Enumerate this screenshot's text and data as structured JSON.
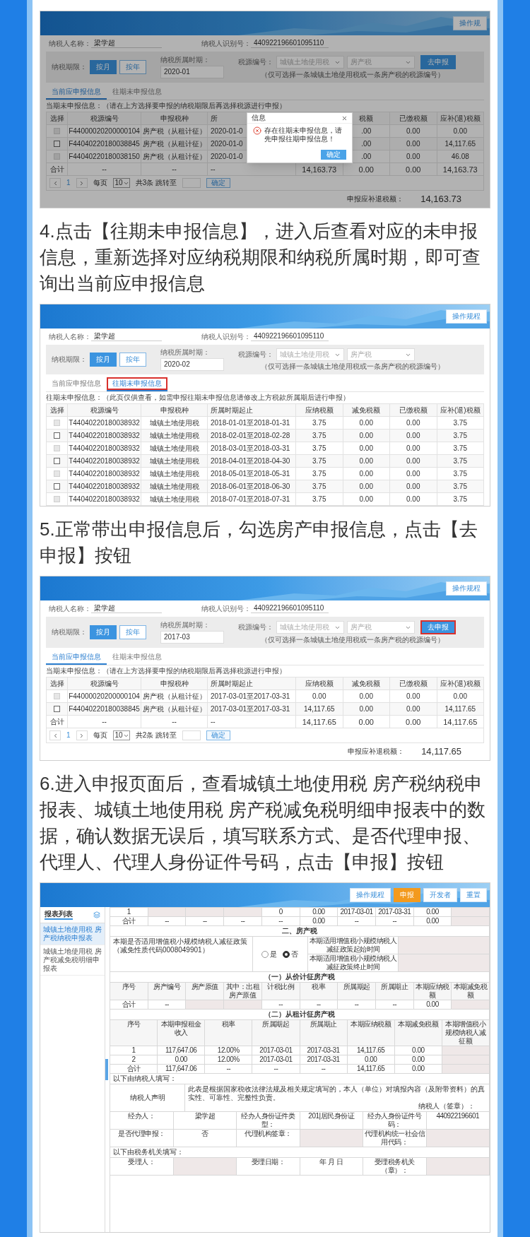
{
  "blocks": [
    {
      "kind": "query-screen",
      "banner_buttons": [
        {
          "label": "操作规",
          "primary": false
        }
      ],
      "taxpayer_name_label": "纳税人名称：",
      "taxpayer_name": "梁学超",
      "taxpayer_id_label": "纳税人识别号：",
      "taxpayer_id": "440922196601095110",
      "period_label": "纳税期限：",
      "period_options": [
        {
          "label": "按月",
          "selected": true
        },
        {
          "label": "按年",
          "selected": false
        }
      ],
      "tax_period_label": "纳税所属时期：",
      "tax_period": "2020-01",
      "source_label": "税源编号：",
      "source_selects": [
        {
          "placeholder": "城镇土地使用税"
        },
        {
          "placeholder": "房产税"
        }
      ],
      "submit_button": {
        "label": "去申报",
        "highlighted": false
      },
      "source_hint": "（仅可选择一条城镇土地使用税或一条房产税的税源编号）",
      "tabs": [
        {
          "label": "当前应申报信息",
          "selected": true,
          "highlighted": false
        },
        {
          "label": "往期未申报信息",
          "selected": false,
          "highlighted": false
        }
      ],
      "table_hint": "当期未申报信息：（请在上方选择要申报的纳税期限后再选择税源进行申报）",
      "select_column": "选择",
      "columns": [
        "税源编号",
        "申报税种",
        "所",
        null,
        "税额",
        "已缴税额",
        "应补(退)税额"
      ],
      "rows": [
        {
          "kind": "item",
          "disabled": true,
          "cells": [
            "F44000020200000104",
            "房产税（从租计征）",
            "2020-01-0",
            null,
            ".00",
            "0.00",
            "0.00"
          ]
        },
        {
          "kind": "item",
          "disabled": false,
          "cells": [
            "F44040220180038845",
            "房产税（从租计征）",
            "2020-01-0",
            null,
            ".00",
            "0.00",
            "14,117.65"
          ]
        },
        {
          "kind": "item",
          "disabled": true,
          "cells": [
            "F44040220180038150",
            "房产税（从租计征）",
            "2020-01-0",
            null,
            ".00",
            "0.00",
            "46.08"
          ]
        },
        {
          "kind": "total",
          "label": "合计",
          "cells": [
            "--",
            "--",
            "--",
            "14,163.73",
            "0.00",
            "0.00",
            "14,163.73"
          ]
        }
      ],
      "pagination": {
        "page": "1",
        "per_page_label": "每页",
        "per_page": "10",
        "count_label": "共3条 跳转至",
        "go_button": "确定"
      },
      "total_label": "申报应补退税额：",
      "total": "14,163.73",
      "dialog": {
        "title": "信息",
        "message": "存在往期未申报信息，请先申报往期申报信息！",
        "button": "确定"
      }
    },
    {
      "kind": "text",
      "text": "4.点击【往期未申报信息】，进入后查看对应的未申报信息，重新选择对应纳税期限和纳税所属时期，即可查询出当前应申报信息"
    },
    {
      "kind": "query-screen",
      "banner_buttons": [
        {
          "label": "操作规程",
          "primary": false
        }
      ],
      "taxpayer_name_label": "纳税人名称：",
      "taxpayer_name": "梁学超",
      "taxpayer_id_label": "纳税人识别号：",
      "taxpayer_id": "440922196601095110",
      "period_label": "纳税期限：",
      "period_options": [
        {
          "label": "按月",
          "selected": true
        },
        {
          "label": "按年",
          "selected": false
        }
      ],
      "tax_period_label": "纳税所属时期：",
      "tax_period": "2020-02",
      "source_label": "税源编号：",
      "source_selects": [
        {
          "placeholder": "城镇土地使用税"
        },
        {
          "placeholder": "房产税"
        }
      ],
      "source_hint": "（仅可选择一条城镇土地使用税或一条房产税的税源编号）",
      "tabs": [
        {
          "label": "当前应申报信息",
          "selected": false,
          "highlighted": false
        },
        {
          "label": "往期未申报信息",
          "selected": true,
          "highlighted": true
        }
      ],
      "table_hint": "往期未申报信息：（此页仅供查看，如需申报往期未申报信息请修改上方税款所属期后进行申报）",
      "select_column": "选择",
      "columns": [
        "税源编号",
        "申报税种",
        "所属时期起止",
        "应纳税额",
        "减免税额",
        "已缴税额",
        "应补(退)税额"
      ],
      "rows": [
        {
          "kind": "item",
          "disabled": true,
          "cells": [
            "T44040220180038932",
            "城镇土地使用税",
            "2018-01-01至2018-01-31",
            "3.75",
            "0.00",
            "0.00",
            "3.75"
          ]
        },
        {
          "kind": "item",
          "disabled": false,
          "cells": [
            "T44040220180038932",
            "城镇土地使用税",
            "2018-02-01至2018-02-28",
            "3.75",
            "0.00",
            "0.00",
            "3.75"
          ]
        },
        {
          "kind": "item",
          "disabled": true,
          "cells": [
            "T44040220180038932",
            "城镇土地使用税",
            "2018-03-01至2018-03-31",
            "3.75",
            "0.00",
            "0.00",
            "3.75"
          ]
        },
        {
          "kind": "item",
          "disabled": false,
          "cells": [
            "T44040220180038932",
            "城镇土地使用税",
            "2018-04-01至2018-04-30",
            "3.75",
            "0.00",
            "0.00",
            "3.75"
          ]
        },
        {
          "kind": "item",
          "disabled": true,
          "cells": [
            "T44040220180038932",
            "城镇土地使用税",
            "2018-05-01至2018-05-31",
            "3.75",
            "0.00",
            "0.00",
            "3.75"
          ]
        },
        {
          "kind": "item",
          "disabled": false,
          "cells": [
            "T44040220180038932",
            "城镇土地使用税",
            "2018-06-01至2018-06-30",
            "3.75",
            "0.00",
            "0.00",
            "3.75"
          ]
        },
        {
          "kind": "item",
          "disabled": true,
          "cells": [
            "T44040220180038932",
            "城镇土地使用税",
            "2018-07-01至2018-07-31",
            "3.75",
            "0.00",
            "0.00",
            "3.75"
          ]
        }
      ]
    },
    {
      "kind": "text",
      "text": "5.正常带出申报信息后，勾选房产申报信息，点击【去申报】按钮"
    },
    {
      "kind": "query-screen",
      "banner_buttons": [
        {
          "label": "操作规程",
          "primary": false
        }
      ],
      "taxpayer_name_label": "纳税人名称：",
      "taxpayer_name": "梁学超",
      "taxpayer_id_label": "纳税人识别号：",
      "taxpayer_id": "440922196601095110",
      "period_label": "纳税期限：",
      "period_options": [
        {
          "label": "按月",
          "selected": true
        },
        {
          "label": "按年",
          "selected": false
        }
      ],
      "tax_period_label": "纳税所属时期：",
      "tax_period": "2017-03",
      "source_label": "税源编号：",
      "source_selects": [
        {
          "placeholder": "城镇土地使用税"
        },
        {
          "placeholder": "房产税"
        }
      ],
      "submit_button": {
        "label": "去申报",
        "highlighted": true
      },
      "source_hint": "（仅可选择一条城镇土地使用税或一条房产税的税源编号）",
      "tabs": [
        {
          "label": "当前应申报信息",
          "selected": true,
          "highlighted": false
        },
        {
          "label": "往期未申报信息",
          "selected": false,
          "highlighted": false
        }
      ],
      "table_hint": "当期未申报信息：（请在上方选择要申报的纳税期限后再选择税源进行申报）",
      "select_column": "选择",
      "columns": [
        "税源编号",
        "申报税种",
        "所属时期起止",
        "应纳税额",
        "减免税额",
        "已缴税额",
        "应补(退)税额"
      ],
      "rows": [
        {
          "kind": "item",
          "disabled": true,
          "cells": [
            "F44000020200000104",
            "房产税（从租计征）",
            "2017-03-01至2017-03-31",
            "0.00",
            "0.00",
            "0.00",
            "0.00"
          ]
        },
        {
          "kind": "item",
          "disabled": false,
          "cells": [
            "F44040220180038845",
            "房产税（从租计征）",
            "2017-03-01至2017-03-31",
            "14,117.65",
            "0.00",
            "0.00",
            "14,117.65"
          ]
        },
        {
          "kind": "total",
          "label": "合计",
          "cells": [
            "--",
            "--",
            "--",
            "14,117.65",
            "0.00",
            "0.00",
            "14,117.65"
          ]
        }
      ],
      "pagination": {
        "page": "1",
        "per_page_label": "每页",
        "per_page": "10",
        "count_label": "共2条 跳转至",
        "go_button": "确定"
      },
      "total_label": "申报应补退税额：",
      "total": "14,117.65"
    },
    {
      "kind": "text",
      "text": "6.进入申报页面后，查看城镇土地使用税 房产税纳税申报表、城镇土地使用税 房产税减免税明细申报表中的数据，确认数据无误后，填写联系方式、是否代理申报、代理人、代理人身份证件号码，点击【申报】按钮"
    },
    {
      "kind": "form-screen",
      "banner_buttons": [
        {
          "label": "操作规程",
          "primary": false
        },
        {
          "label": "申报",
          "primary": true
        },
        {
          "label": "开发者",
          "primary": false
        },
        {
          "label": "重置",
          "primary": false
        }
      ],
      "sidebar": {
        "title": "报表列表",
        "items": [
          {
            "label": "城镇土地使用税 房产税纳税申报表",
            "selected": true
          },
          {
            "label": "城镇土地使用税 房产税减免税明细申报表",
            "selected": false
          }
        ]
      },
      "form_rows": [
        {
          "kind": "cells",
          "cells": [
            "1",
            null,
            null,
            null,
            "0",
            "0.00",
            "2017-03-01",
            "2017-03-31",
            "0.00",
            null
          ]
        },
        {
          "kind": "cells",
          "cells": [
            "合计",
            "--",
            "--",
            "--",
            "--",
            "0.00",
            "--",
            "--",
            "0.00",
            null
          ]
        },
        {
          "kind": "section",
          "text": "二、房产税"
        },
        {
          "kind": "policy",
          "label": "本期是否适用增值税小规模纳税人减征政策（减免性质代码0008049901）",
          "options": [
            {
              "label": "是",
              "selected": false
            },
            {
              "label": "否",
              "selected": true
            }
          ],
          "start_label": "本期适用增值税小规模纳税人减征政策起始时间",
          "end_label": "本期适用增值税小规模纳税人减征政策终止时间"
        },
        {
          "kind": "section",
          "text": "（一）从价计征房产税"
        },
        {
          "kind": "header",
          "cells": [
            "序号",
            "房产编号",
            "房产原值",
            "其中：出租房产原值",
            "计税比例",
            "税率",
            "所属期起",
            "所属期止",
            "本期应纳税额",
            "本期减免税额"
          ]
        },
        {
          "kind": "cells",
          "cells": [
            "合计",
            "--",
            null,
            null,
            "--",
            "--",
            "--",
            "--",
            "0.00",
            null
          ]
        },
        {
          "kind": "section",
          "text": "（二）从租计征房产税"
        },
        {
          "kind": "header",
          "cells": [
            "序号",
            "本期申报租金收入",
            "税率",
            "所属期起",
            "所属期止",
            "本期应纳税额",
            "本期减免税额",
            "本期增值税小规模纳税人减征额"
          ]
        },
        {
          "kind": "cells",
          "cells": [
            "1",
            "117,647.06",
            "12.00%",
            "2017-03-01",
            "2017-03-31",
            "14,117.65",
            "0.00",
            null
          ]
        },
        {
          "kind": "cells",
          "cells": [
            "2",
            "0.00",
            "12.00%",
            "2017-03-01",
            "2017-03-31",
            "0.00",
            "0.00",
            null
          ]
        },
        {
          "kind": "cells",
          "cells": [
            "合计",
            "117,647.06",
            "--",
            "--",
            "--",
            "14,117.65",
            "0.00",
            null
          ]
        },
        {
          "kind": "note",
          "text": "以下由纳税人填写："
        },
        {
          "kind": "declaration",
          "label": "纳税人声明",
          "statement": "此表是根据国家税收法律法规及相关规定填写的，本人（单位）对填报内容（及附带资料）的真实性、可靠性、完整性负责。",
          "signature": "纳税人（签章）："
        },
        {
          "kind": "cells",
          "cells": [
            "经办人：",
            "梁学超",
            "经办人身份证件类型：",
            "201|居民身份证",
            "经办人身份证件号码：",
            "440922196601"
          ]
        },
        {
          "kind": "cells",
          "cells": [
            "是否代理申报：",
            "否",
            "代理机构签章：",
            null,
            "代理机构统一社会信用代码：",
            null
          ]
        },
        {
          "kind": "note",
          "text": "以下由税务机关填写："
        },
        {
          "kind": "cells",
          "cells": [
            "受理人：",
            null,
            "受理日期：",
            "年 月 日",
            "受理税务机关（章）：",
            null
          ]
        }
      ]
    }
  ]
}
